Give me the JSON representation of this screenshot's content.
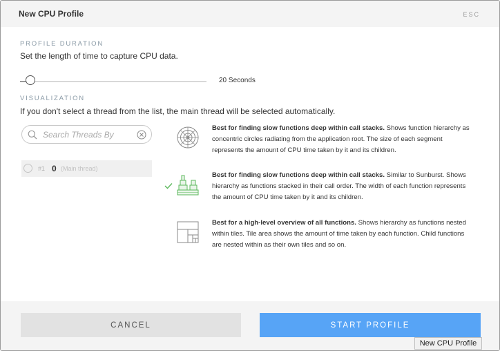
{
  "dialog": {
    "title": "New CPU Profile",
    "esc_label": "ESC"
  },
  "duration": {
    "label": "PROFILE DURATION",
    "description": "Set the length of time to capture CPU data.",
    "value_label": "20 Seconds",
    "slider_fraction": 0.05
  },
  "visualization": {
    "label": "VISUALIZATION",
    "description": "If you don't select a thread from the list, the main thread will be selected automatically.",
    "options": [
      {
        "icon": "sunburst-icon",
        "heading": "Best for finding slow functions deep within call stacks.",
        "body": " Shows function hierarchy as concentric circles radiating from the application root. The size of each segment represents the amount of CPU time taken by it and its children.",
        "selected": false
      },
      {
        "icon": "flame-graph-icon",
        "heading": "Best for finding slow functions deep within call stacks.",
        "body": " Similar to Sunburst. Shows hierarchy as functions stacked in their call order. The width of each function represents the amount of CPU time taken by it and its children.",
        "selected": true
      },
      {
        "icon": "treemap-icon",
        "heading": "Best for a high-level overview of all functions.",
        "body": " Shows hierarchy as functions nested within tiles. Tile area shows the amount of time taken by each function. Child functions are nested within as their own tiles and so on.",
        "selected": false
      }
    ]
  },
  "threads": {
    "search_placeholder": "Search Threads By",
    "items": [
      {
        "number": "#1",
        "id": "0",
        "name": "(Main thread)"
      }
    ]
  },
  "buttons": {
    "cancel": "CANCEL",
    "start": "START PROFILE"
  },
  "tooltip": "New CPU Profile",
  "colors": {
    "accent": "#57a4f6",
    "check": "#5cb85c",
    "header_bg": "#f4f4f4"
  }
}
